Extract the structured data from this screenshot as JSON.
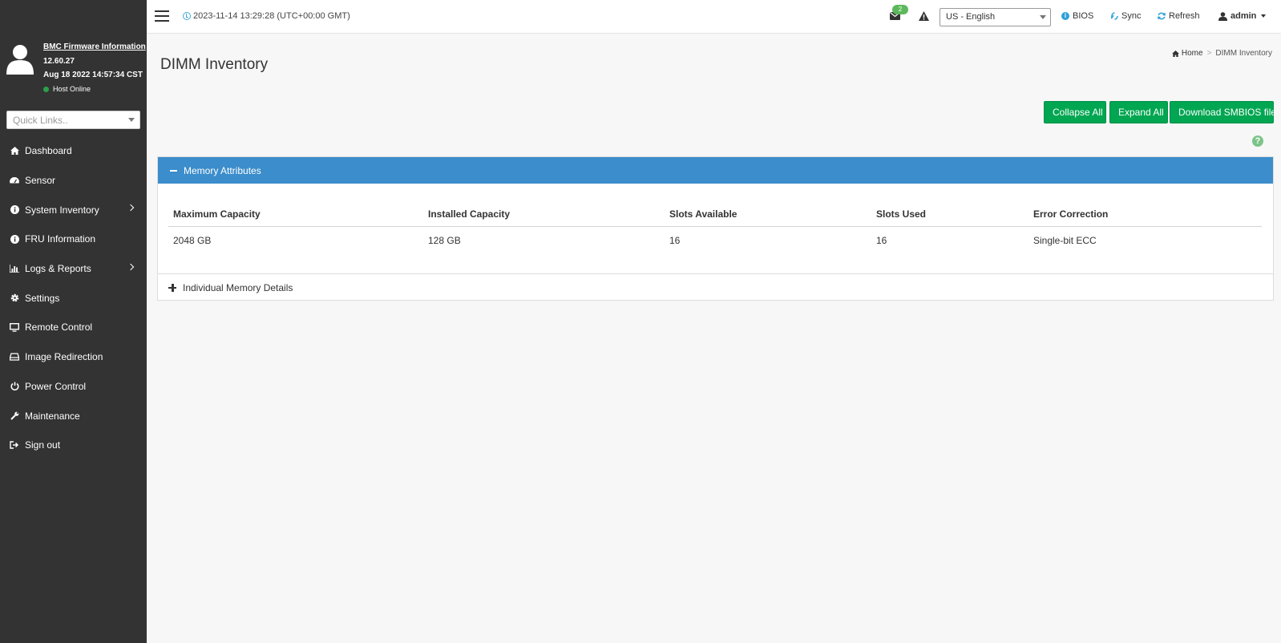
{
  "sidebar": {
    "fw_title": "BMC Firmware Information",
    "fw_version": "12.60.27",
    "fw_date": "Aug 18 2022 14:57:34 CST",
    "host_status": "Host Online",
    "quicklinks_placeholder": "Quick Links..",
    "items": [
      {
        "label": "Dashboard",
        "icon": "home-icon"
      },
      {
        "label": "Sensor",
        "icon": "gauge-icon"
      },
      {
        "label": "System Inventory",
        "icon": "info-icon",
        "submenu": true
      },
      {
        "label": "FRU Information",
        "icon": "info-icon"
      },
      {
        "label": "Logs & Reports",
        "icon": "bar-chart-icon",
        "submenu": true
      },
      {
        "label": "Settings",
        "icon": "gear-icon"
      },
      {
        "label": "Remote Control",
        "icon": "monitor-icon"
      },
      {
        "label": "Image Redirection",
        "icon": "drive-icon"
      },
      {
        "label": "Power Control",
        "icon": "power-icon"
      },
      {
        "label": "Maintenance",
        "icon": "wrench-icon"
      },
      {
        "label": "Sign out",
        "icon": "sign-out-icon"
      }
    ]
  },
  "topbar": {
    "datetime": "2023-11-14 13:29:28 (UTC+00:00 GMT)",
    "mail_count": "2",
    "language": "US - English",
    "bios_label": "BIOS",
    "sync_label": "Sync",
    "refresh_label": "Refresh",
    "user_label": "admin"
  },
  "breadcrumb": {
    "home": "Home",
    "separator": ">",
    "current": "DIMM Inventory"
  },
  "page": {
    "title": "DIMM Inventory",
    "collapse_all": "Collapse All",
    "expand_all": "Expand All",
    "download_smbios": "Download SMBIOS file",
    "help": "?"
  },
  "memory_attributes": {
    "header": "Memory Attributes",
    "columns": [
      "Maximum Capacity",
      "Installed Capacity",
      "Slots Available",
      "Slots Used",
      "Error Correction"
    ],
    "row": [
      "2048 GB",
      "128 GB",
      "16",
      "16",
      "Single-bit ECC"
    ]
  },
  "individual_details": {
    "header": "Individual Memory Details"
  },
  "colors": {
    "sidebar_bg": "#333333",
    "accent_blue": "#3c8dcb",
    "button_green": "#00a651"
  }
}
